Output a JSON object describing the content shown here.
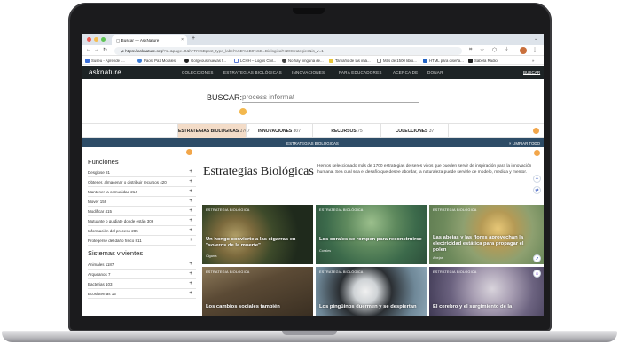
{
  "browser": {
    "tab_title": "Buscar — AskNature",
    "tab_close": "×",
    "new_tab": "+",
    "url_prefix": "https://",
    "url_host": "asknature.org",
    "url_rest": "/?s=&page=0&hFR%5Bpost_type_label%5D%5B0%5D=Biological%20Strategies&is_v=1",
    "bookmarks": [
      "Suseu - Aprende i...",
      "Paolo Paz Morales",
      "Gorgeous nuevas f...",
      "LCHH – Logos Chil...",
      "No hay ninguna de...",
      "Tamaño de las imá...",
      "Más de 1500 libro...",
      "HTML para diseña...",
      "Sábela Radio"
    ],
    "bookmarks_more": "»",
    "colors": {
      "close": "#ee5c54",
      "minimize": "#f5bd4f",
      "maximize": "#5fc454"
    }
  },
  "site": {
    "logo": "asknature",
    "nav": [
      "COLECCIONES",
      "ESTRATEGIAS BIOLÓGICAS",
      "INNOVACIONES",
      "PARA EDUCADORES",
      "ACERCA DE",
      "DONAR"
    ],
    "buscar_link": "BUSCAR"
  },
  "search": {
    "label": "BUSCAR:",
    "placeholder": "process informat"
  },
  "tabs": [
    {
      "label": "ESTRATEGIAS BIOLÓGICAS",
      "count": "1767"
    },
    {
      "label": "INNOVACIONES",
      "count": "307"
    },
    {
      "label": "RECURSOS",
      "count": "75"
    },
    {
      "label": "COLECCIONES",
      "count": "37"
    }
  ],
  "filter_bar": {
    "active": "ESTRATEGIAS BIOLÓGICAS",
    "clear": "× LIMPIAR TODO"
  },
  "sidebar": {
    "funciones_title": "Funciones",
    "funciones": [
      "Desglose 81",
      "Obtener, almacenar o distribuir recursos 420",
      "Mantener la comunidad 214",
      "Mover 159",
      "Modificar 415",
      "Mutuante o quidiate donde están 306",
      "Información del proceso 285",
      "Protegerse del daño físico 811"
    ],
    "sistemas_title": "Sistemas vivientes",
    "sistemas": [
      "Animales 1187",
      "Arqueanos 7",
      "Bacterias 103",
      "Ecosistemas 15"
    ]
  },
  "main": {
    "title": "Estrategias Biológicas",
    "description": "Hemos seleccionado más de 1700 estrategias de seres vivos que pueden servir de inspiración para la innovación humana. Sea cual sea el desafío que desee abordar, la naturaleza puede servirle de modelo, medida y mentor."
  },
  "cards": [
    {
      "tag": "ESTRATEGIA BIOLÓGICA",
      "title": "Un hongo convierte a las cigarras en \"soleros de la muerte\"",
      "organism": "Cigarra"
    },
    {
      "tag": "ESTRATEGIA BIOLÓGICA",
      "title": "Los corales se rompen para reconstruirse",
      "organism": "Corales"
    },
    {
      "tag": "ESTRATEGIA BIOLÓGICA",
      "title": "Las abejas y las flores aprovechan la electricidad estática para propagar el polen",
      "organism": "Abejas"
    },
    {
      "tag": "ESTRATEGIA BIOLÓGICA",
      "title": "Los cambios sociales también",
      "organism": ""
    },
    {
      "tag": "ESTRATEGIA BIOLÓGICA",
      "title": "Los pingüinos duermen y se despiertan",
      "organism": ""
    },
    {
      "tag": "ESTRATEGIA BIOLÓGICA",
      "title": "El cerebro y el surgimiento de la",
      "organism": ""
    }
  ],
  "colors": {
    "nav_bg": "#1d2325",
    "filter_bar": "#2d4c67",
    "active_tab": "#f3dcc8",
    "accent": "#f2a64a"
  }
}
